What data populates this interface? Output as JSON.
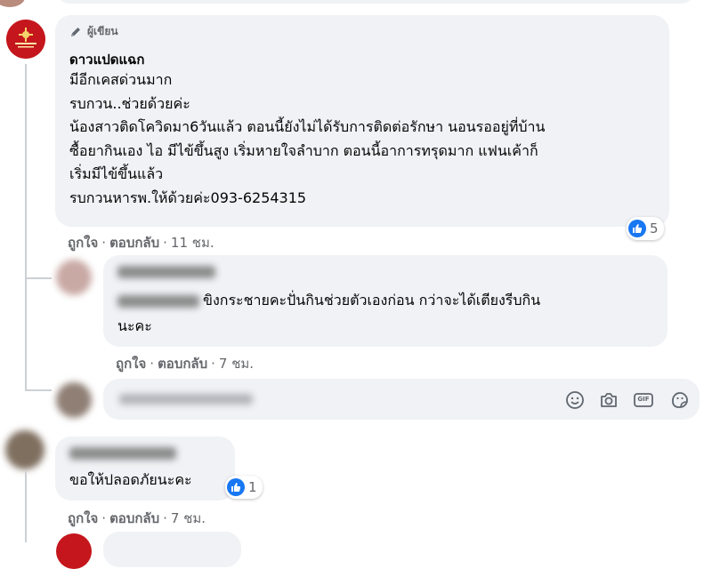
{
  "top_comment": {
    "author_badge": "ผู้เขียน",
    "author_name": "ดาวแปดแฉก",
    "lines": [
      "มีอีกเคสด่วนมาก",
      "รบกวน..ช่วยด้วยค่ะ",
      "น้องสาวติดโควิดมา6วันแล้ว ตอนนี้ยังไม่ได้รับการติดต่อรักษา นอนรออยู่ที่บ้าน",
      "ซื้อยากินเอง ไอ มีไข้ขึ้นสูง เริ่มหายใจลำบาก ตอนนี้อาการทรุดมาก แฟนเค้าก็",
      "เริ่มมีไข้ขึ้นแล้ว",
      "รบกวนหารพ.ให้ด้วยค่ะ093-6254315"
    ],
    "reactions_count": "5",
    "like_label": "ถูกใจ",
    "reply_label": "ตอบกลับ",
    "time": "11 ชม."
  },
  "reply_1": {
    "lines": [
      "ขิงกระชายคะปั่นกินช่วยตัวเองก่อน กว่าจะได้เตียงรีบกิน",
      "นะคะ"
    ],
    "like_label": "ถูกใจ",
    "reply_label": "ตอบกลับ",
    "time": "7 ชม."
  },
  "reply_input": {
    "icons": [
      "smile-icon",
      "camera-icon",
      "gif-icon",
      "sticker-icon"
    ],
    "gif_text": "GIF"
  },
  "comment_2": {
    "text": "ขอให้ปลอดภัยนะคะ",
    "reactions_count": "1",
    "like_label": "ถูกใจ",
    "reply_label": "ตอบกลับ",
    "time": "7 ชม."
  },
  "colors": {
    "bubble": "#f0f2f5",
    "meta_text": "#65676b",
    "like_blue": "#1877f2",
    "thread_line": "#ccd0d5"
  }
}
